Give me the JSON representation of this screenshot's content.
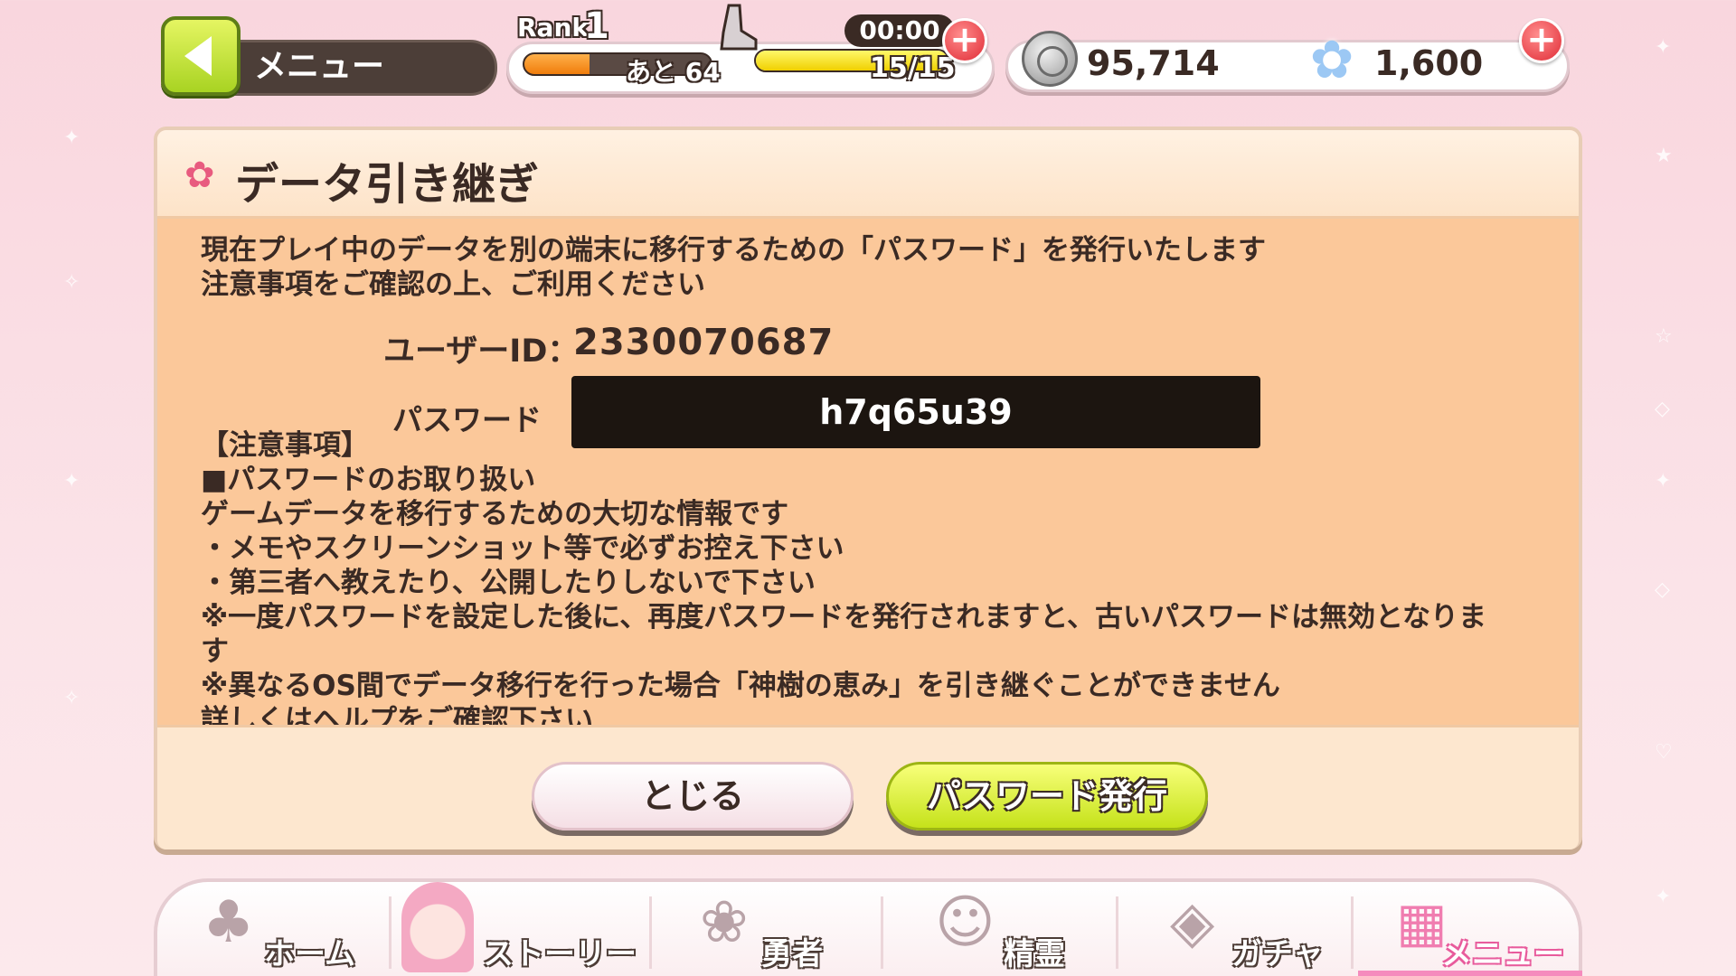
{
  "topbar": {
    "menu_label": "メニュー",
    "rank_label": "Rank",
    "rank_value": "1",
    "rank_next": "あと 64",
    "rank_progress": 0.35,
    "timer": "00:00",
    "stamina": "15/15",
    "stamina_progress": 1.0,
    "coins": "95,714",
    "gems": "1,600"
  },
  "dialog": {
    "title": "データ引き継ぎ",
    "intro_line1": "現在プレイ中のデータを別の端末に移行するための「パスワード」を発行いたします",
    "intro_line2": "注意事項をご確認の上、ご利用ください",
    "userid_label": "ユーザーID：",
    "userid_value": "2330070687",
    "password_label": "パスワード",
    "password_value": "h7q65u39",
    "notes": [
      "【注意事項】",
      "■パスワードのお取り扱い",
      "ゲームデータを移行するための大切な情報です",
      "・メモやスクリーンショット等で必ずお控え下さい",
      "・第三者へ教えたり、公開したりしないで下さい",
      "※一度パスワードを設定した後に、再度パスワードを発行されますと、古いパスワードは無効となりま",
      "す",
      "※異なるOS間でデータ移行を行った場合「神樹の恵み」を引き継ぐことができません",
      "詳しくはヘルプをご確認下さい"
    ],
    "close_button": "とじる",
    "issue_button": "パスワード発行"
  },
  "nav": {
    "items": [
      {
        "label": "ホーム",
        "icon": "tree-icon"
      },
      {
        "label": "ストーリー",
        "icon": "character-icon"
      },
      {
        "label": "勇者",
        "icon": "flower-emblem-icon"
      },
      {
        "label": "精霊",
        "icon": "spirit-icon"
      },
      {
        "label": "ガチャ",
        "icon": "gacha-icon"
      },
      {
        "label": "メニュー",
        "icon": "grid-icon"
      }
    ],
    "active": "メニュー"
  },
  "colors": {
    "accent_pink": "#f58bbd",
    "button_green": "#c5e21a",
    "password_box": "#1c1510",
    "dialog_body": "#fbc89a"
  }
}
